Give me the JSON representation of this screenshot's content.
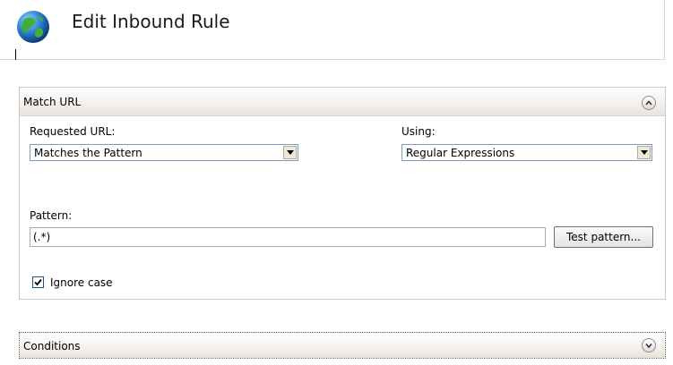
{
  "header": {
    "title": "Edit Inbound Rule",
    "icon": "globe-icon"
  },
  "match_url": {
    "title": "Match URL",
    "requested_url_label": "Requested URL:",
    "requested_url_value": "Matches the Pattern",
    "using_label": "Using:",
    "using_value": "Regular Expressions",
    "pattern_label": "Pattern:",
    "pattern_value": "(.*)",
    "test_button": "Test pattern...",
    "ignore_case_label": "Ignore case",
    "ignore_case_checked": true
  },
  "conditions": {
    "title": "Conditions"
  },
  "colors": {
    "section_border": "#c7c9cc",
    "input_border": "#7f9db9"
  }
}
